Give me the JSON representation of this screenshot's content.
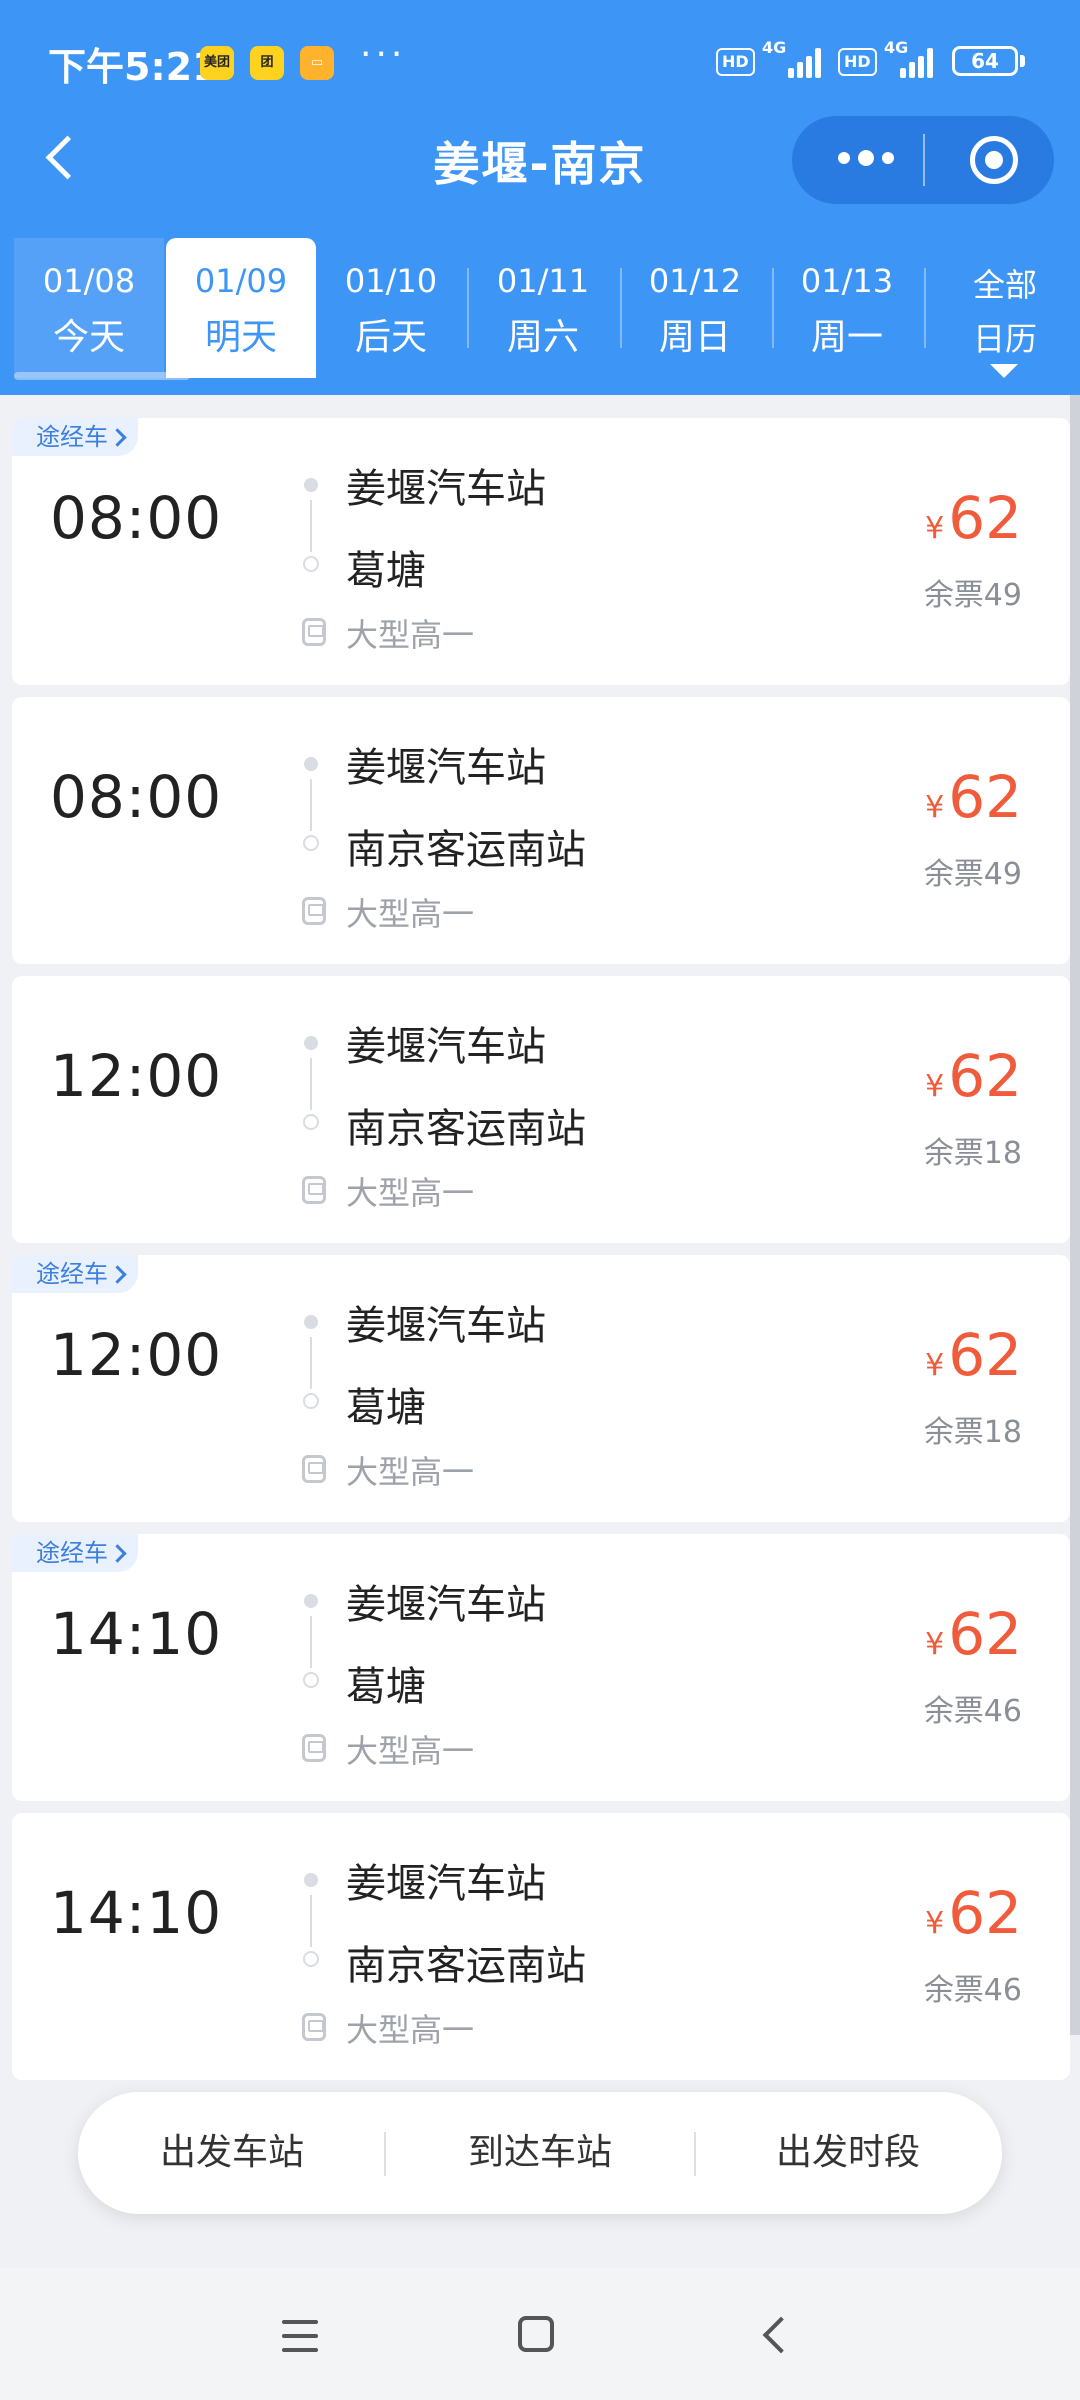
{
  "status_bar": {
    "time": "下午5:21",
    "badges": [
      "美团",
      "团",
      ""
    ],
    "more": "···",
    "hd1": "HD",
    "net1": "4G",
    "hd2": "HD",
    "net2": "4G",
    "battery": "64"
  },
  "nav": {
    "title": "姜堰-南京"
  },
  "date_tabs": [
    {
      "date": "01/08",
      "day": "今天"
    },
    {
      "date": "01/09",
      "day": "明天"
    },
    {
      "date": "01/10",
      "day": "后天"
    },
    {
      "date": "01/11",
      "day": "周六"
    },
    {
      "date": "01/12",
      "day": "周日"
    },
    {
      "date": "01/13",
      "day": "周一"
    }
  ],
  "all_calendar": {
    "line1": "全部",
    "line2": "日历"
  },
  "trips": [
    {
      "via": "途经车",
      "time": "08:00",
      "from": "姜堰汽车站",
      "to": "葛塘",
      "bus_type": "大型高一",
      "currency": "¥",
      "price": "62",
      "tickets": "余票49"
    },
    {
      "via": "",
      "time": "08:00",
      "from": "姜堰汽车站",
      "to": "南京客运南站",
      "bus_type": "大型高一",
      "currency": "¥",
      "price": "62",
      "tickets": "余票49"
    },
    {
      "via": "",
      "time": "12:00",
      "from": "姜堰汽车站",
      "to": "南京客运南站",
      "bus_type": "大型高一",
      "currency": "¥",
      "price": "62",
      "tickets": "余票18"
    },
    {
      "via": "途经车",
      "time": "12:00",
      "from": "姜堰汽车站",
      "to": "葛塘",
      "bus_type": "大型高一",
      "currency": "¥",
      "price": "62",
      "tickets": "余票18"
    },
    {
      "via": "途经车",
      "time": "14:10",
      "from": "姜堰汽车站",
      "to": "葛塘",
      "bus_type": "大型高一",
      "currency": "¥",
      "price": "62",
      "tickets": "余票46"
    },
    {
      "via": "",
      "time": "14:10",
      "from": "姜堰汽车站",
      "to": "南京客运南站",
      "bus_type": "大型高一",
      "currency": "¥",
      "price": "62",
      "tickets": "余票46"
    }
  ],
  "filters": [
    "出发车站",
    "到达车站",
    "出发时段"
  ],
  "colors": {
    "brand_blue": "#3d95f6",
    "price_red": "#f05b3c",
    "via_tag_text": "#3d7fde"
  }
}
